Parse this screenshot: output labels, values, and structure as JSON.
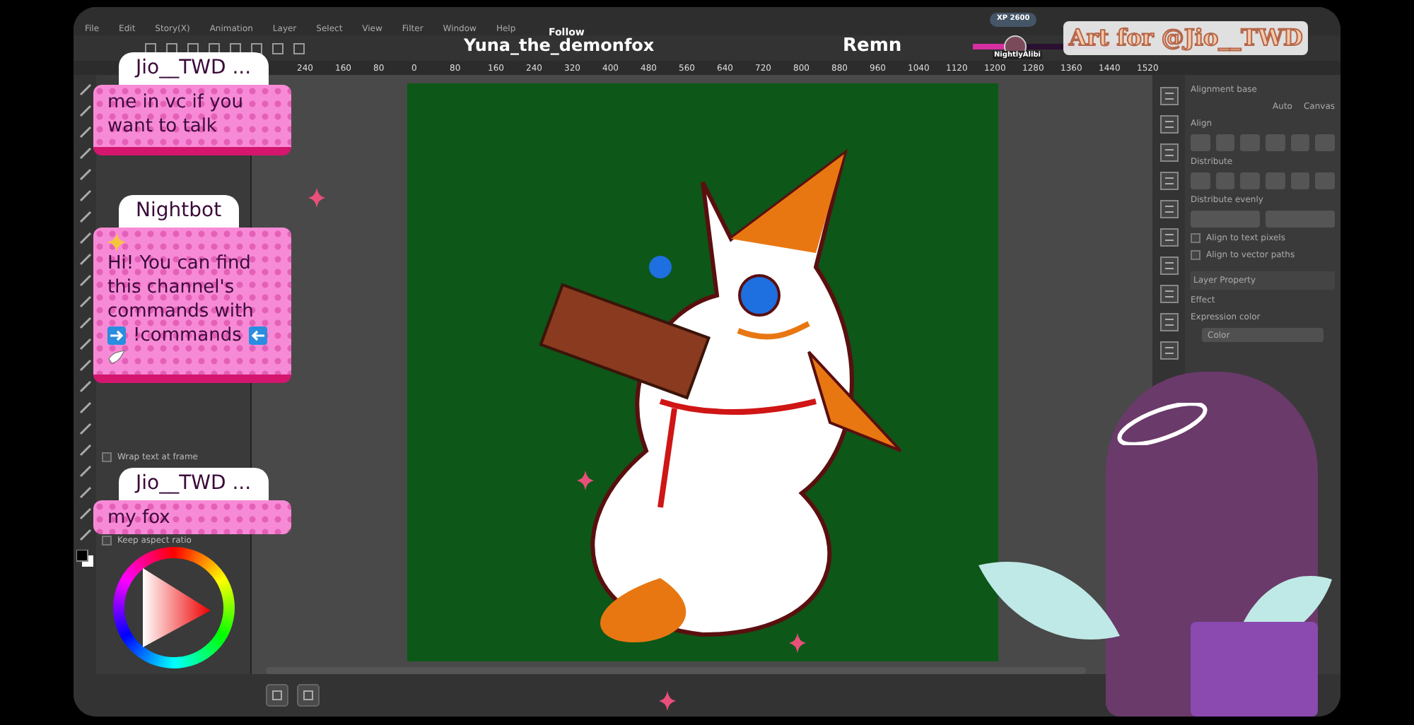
{
  "menu": [
    "File",
    "Edit",
    "Story(X)",
    "Animation",
    "Layer",
    "Select",
    "View",
    "Filter",
    "Window",
    "Help"
  ],
  "ruler": [
    "240",
    "160",
    "80",
    "0",
    "80",
    "160",
    "240",
    "320",
    "400",
    "480",
    "560",
    "640",
    "720",
    "800",
    "880",
    "960",
    "1040",
    "1120",
    "1200",
    "1280",
    "1360",
    "1440",
    "1520"
  ],
  "overlay": {
    "follow_label": "Follow",
    "follower": "Yuna_the_demonfox",
    "ticker": "Remn",
    "xp_badge": "XP 2600",
    "xp_bar": {
      "level": 0.35
    },
    "viewer": "NightlyAlibi",
    "banner": "Art for @Jio__TWD"
  },
  "chat": [
    {
      "user": "Jio__TWD ...",
      "parts": [
        {
          "kind": "text",
          "text": "me in vc if you want to talk"
        }
      ]
    },
    {
      "user": "Nightbot",
      "parts": [
        {
          "kind": "sparkle"
        },
        {
          "kind": "text",
          "text": "Hi! You can find this channel's commands with"
        },
        {
          "kind": "arrow-right"
        },
        {
          "kind": "text",
          "text": "!commands"
        },
        {
          "kind": "arrow-left"
        },
        {
          "kind": "dove"
        }
      ]
    },
    {
      "user": "Jio__TWD ...",
      "parts": [
        {
          "kind": "text",
          "text": "my fox"
        }
      ]
    }
  ],
  "left_panel": {
    "options": [
      {
        "label": "Wrap text at frame",
        "checked": false
      },
      {
        "label": "Keep aspect ratio",
        "checked": false
      }
    ]
  },
  "right_panel": {
    "alignment_base": "Alignment base",
    "modes": [
      "Auto",
      "Canvas"
    ],
    "align": "Align",
    "distribute": "Distribute",
    "distribute_evenly": "Distribute evenly",
    "options": [
      {
        "label": "Align to text pixels",
        "checked": false
      },
      {
        "label": "Align to vector paths",
        "checked": false
      }
    ],
    "layer_property": "Layer Property",
    "effect": "Effect",
    "expression_color": "Expression color",
    "expression_value": "Color"
  }
}
